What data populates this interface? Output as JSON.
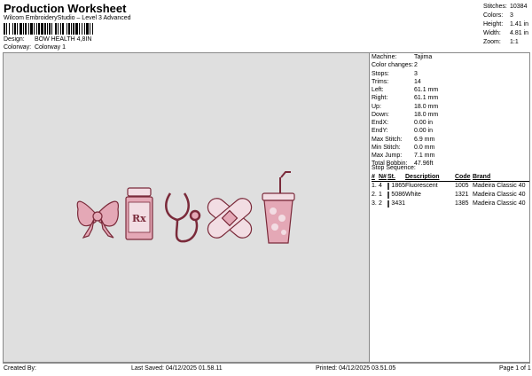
{
  "header": {
    "title": "Production Worksheet",
    "subtitle": "Wilcom EmbroideryStudio – Level 3 Advanced",
    "design_label": "Design:",
    "design_value": "BOW HEALTH 4,8IN",
    "colorway_label": "Colorway:",
    "colorway_value": "Colorway 1"
  },
  "summary": [
    {
      "label": "Stitches:",
      "value": "10384"
    },
    {
      "label": "Colors:",
      "value": "3"
    },
    {
      "label": "Height:",
      "value": "1.41 in"
    },
    {
      "label": "Width:",
      "value": "4.81 in"
    },
    {
      "label": "Zoom:",
      "value": "1:1"
    }
  ],
  "details": [
    {
      "label": "Machine:",
      "value": "Tajima"
    },
    {
      "label": "Color changes:",
      "value": "2"
    },
    {
      "label": "Stops:",
      "value": "3"
    },
    {
      "label": "Trims:",
      "value": "14"
    },
    {
      "label": "Left:",
      "value": "61.1 mm"
    },
    {
      "label": "Right:",
      "value": "61.1 mm"
    },
    {
      "label": "Up:",
      "value": "18.0 mm"
    },
    {
      "label": "Down:",
      "value": "18.0 mm"
    },
    {
      "label": "EndX:",
      "value": "0.00 in"
    },
    {
      "label": "EndY:",
      "value": "0.00 in"
    },
    {
      "label": "Max Stitch:",
      "value": "6.9 mm"
    },
    {
      "label": "Min Stitch:",
      "value": "0.0 mm"
    },
    {
      "label": "Max Jump:",
      "value": "7.1 mm"
    },
    {
      "label": "Total Bobbin:",
      "value": "47.96ft"
    }
  ],
  "stop_sequence": {
    "title": "Stop Sequence:",
    "headers": [
      "#",
      "N#",
      "St.",
      "Description",
      "Code",
      "Brand"
    ],
    "rows": [
      {
        "n": "1.",
        "nr": "4",
        "st": "1865",
        "desc": "Fluorescent White",
        "code": "1005",
        "brand": "Madeira Classic 40",
        "color": "#e9ddf0"
      },
      {
        "n": "2.",
        "nr": "1",
        "st": "5086",
        "desc": "",
        "code": "1321",
        "brand": "Madeira Classic 40",
        "color": "#e79bb0"
      },
      {
        "n": "3.",
        "nr": "2",
        "st": "3431",
        "desc": "",
        "code": "1385",
        "brand": "Madeira Classic 40",
        "color": "#5a1420"
      }
    ]
  },
  "footer": {
    "created_by": "Created By:",
    "last_saved": "Last Saved: 04/12/2025 01.58.11",
    "printed": "Printed: 04/12/2025 03.51.05",
    "page": "Page 1 of 1"
  },
  "design_art": {
    "rx_text": "Rx",
    "colors": {
      "pink": "#e4a8b6",
      "dark": "#7a2a3a",
      "light": "#f2dde3"
    }
  }
}
